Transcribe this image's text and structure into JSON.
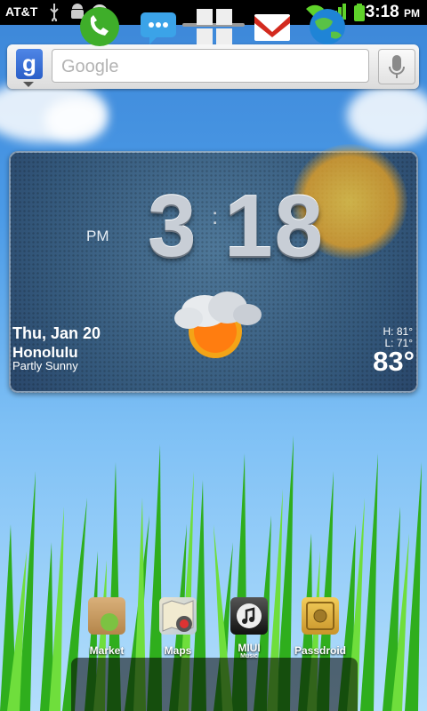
{
  "status_bar": {
    "carrier": "AT&T",
    "time": "3:18",
    "ampm": "PM",
    "icons": [
      "usb-icon",
      "android-debug-icon",
      "sync-icon",
      "wifi-icon",
      "signal-icon",
      "battery-icon"
    ]
  },
  "search": {
    "placeholder": "Google",
    "logo": "g"
  },
  "clock": {
    "hour": "3",
    "minute": "18",
    "ampm": "PM"
  },
  "weather": {
    "date": "Thu, Jan 20",
    "city": "Honolulu",
    "condition": "Partly Sunny",
    "high": "H:  81°",
    "low": "L:  71°",
    "temp": "83°"
  },
  "apps": [
    {
      "label": "Market",
      "icon": "market-icon"
    },
    {
      "label": "Maps",
      "icon": "maps-icon"
    },
    {
      "label": "MIUI",
      "sublabel": "Music",
      "icon": "music-icon"
    },
    {
      "label": "Passdroid",
      "icon": "safe-icon"
    }
  ],
  "dock": [
    {
      "icon": "phone-icon"
    },
    {
      "icon": "messaging-icon"
    },
    {
      "icon": "app-drawer-icon"
    },
    {
      "icon": "gmail-icon"
    },
    {
      "icon": "browser-icon"
    }
  ],
  "colors": {
    "statusbar": "#000000",
    "sky": "#4b9ae6",
    "widget": "#33577a"
  }
}
